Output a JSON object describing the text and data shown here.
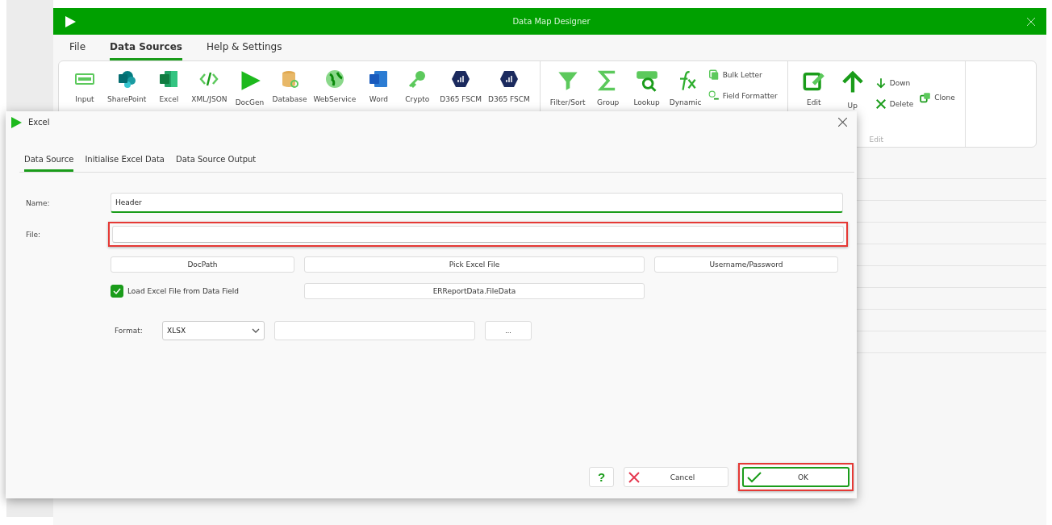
{
  "app": {
    "title": "Data Map Designer"
  },
  "menu_tabs": [
    {
      "label": "File",
      "selected": false
    },
    {
      "label": "Data Sources",
      "selected": true
    },
    {
      "label": "Help & Settings",
      "selected": false
    }
  ],
  "ribbon": {
    "sources": [
      {
        "kind": "input",
        "label": "Input"
      },
      {
        "kind": "sharepoint",
        "label": "SharePoint"
      },
      {
        "kind": "excel",
        "label": "Excel"
      },
      {
        "kind": "xml",
        "label": "XML/JSON"
      },
      {
        "kind": "docgen",
        "label": "DocGen"
      },
      {
        "kind": "database",
        "label": "Database"
      },
      {
        "kind": "web",
        "label": "WebService"
      },
      {
        "kind": "word",
        "label": "Word"
      },
      {
        "kind": "crypto",
        "label": "Crypto"
      },
      {
        "kind": "d365",
        "label": "D365 FSCM"
      },
      {
        "kind": "d365",
        "label": "D365 FSCM"
      }
    ],
    "tools": [
      {
        "kind": "filter",
        "label": "Filter/Sort"
      },
      {
        "kind": "sum",
        "label": "Group"
      },
      {
        "kind": "lookup",
        "label": "Lookup"
      },
      {
        "kind": "fx",
        "label": "Dynamic"
      }
    ],
    "tool_links": [
      {
        "kind": "letter",
        "label": "Bulk Letter"
      },
      {
        "kind": "formatter",
        "label": "Field Formatter"
      }
    ],
    "edit_large": [
      {
        "kind": "edit",
        "label": "Edit"
      },
      {
        "kind": "up",
        "label": "Up"
      }
    ],
    "edit_small": [
      {
        "kind": "down",
        "label": "Down"
      },
      {
        "kind": "delete",
        "label": "Delete"
      }
    ],
    "edit_side": [
      {
        "kind": "clone",
        "label": "Clone"
      }
    ],
    "edit_caption": "Edit"
  },
  "dialog": {
    "title": "Excel",
    "tabs": [
      {
        "label": "Data Source",
        "selected": true
      },
      {
        "label": "Initialise Excel Data",
        "selected": false
      },
      {
        "label": "Data Source Output",
        "selected": false
      }
    ],
    "name": {
      "label": "Name:",
      "value": "Header",
      "highlighted": false
    },
    "file": {
      "label": "File:",
      "highlighted": true
    },
    "path_buttons": [
      "DocPath",
      "Pick Excel File",
      "Username/Password"
    ],
    "load_from_field": {
      "label": "Load Excel File from Data Field",
      "checked": true
    },
    "data_field_button": "ERReportData.FileData",
    "format": {
      "label": "Format:",
      "value": "XLSX",
      "browse": "..."
    },
    "help_button": "?",
    "cancel": {
      "label": "Cancel",
      "highlighted": false
    },
    "ok": {
      "label": "OK",
      "highlighted": true
    }
  }
}
